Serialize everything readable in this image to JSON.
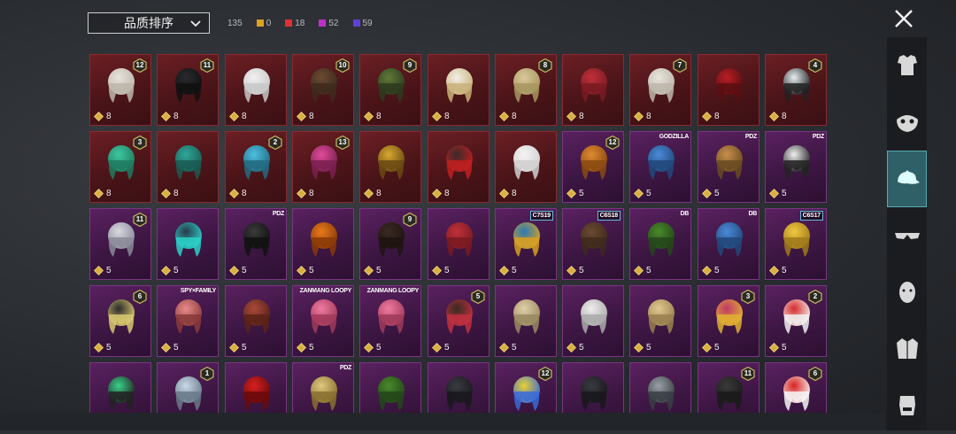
{
  "header": {
    "sort_label": "品质排序",
    "total": "135",
    "stats": [
      {
        "value": "0",
        "color": "#e0a020"
      },
      {
        "value": "18",
        "color": "#e03030"
      },
      {
        "value": "52",
        "color": "#c030c8"
      },
      {
        "value": "59",
        "color": "#6040d8"
      }
    ]
  },
  "sidebar": {
    "categories": [
      "outfit-icon",
      "mask-icon",
      "hat-icon",
      "glasses-icon",
      "face-icon",
      "jacket-icon",
      "emote-icon"
    ],
    "active": "hat-icon"
  },
  "tiles": [
    {
      "rarity": "red",
      "cost": "8",
      "badge": "12",
      "item": "white-hair"
    },
    {
      "rarity": "red",
      "cost": "8",
      "badge": "11",
      "item": "black-helmet"
    },
    {
      "rarity": "red",
      "cost": "8",
      "badge": "",
      "item": "ghost-hair"
    },
    {
      "rarity": "red",
      "cost": "8",
      "badge": "10",
      "item": "brown-hair"
    },
    {
      "rarity": "red",
      "cost": "8",
      "badge": "9",
      "item": "zombie-head"
    },
    {
      "rarity": "red",
      "cost": "8",
      "badge": "",
      "item": "white-hat"
    },
    {
      "rarity": "red",
      "cost": "8",
      "badge": "8",
      "item": "blonde-hair"
    },
    {
      "rarity": "red",
      "cost": "8",
      "badge": "",
      "item": "red-mask"
    },
    {
      "rarity": "red",
      "cost": "8",
      "badge": "7",
      "item": "white-hair"
    },
    {
      "rarity": "red",
      "cost": "8",
      "badge": "",
      "item": "red-helmet"
    },
    {
      "rarity": "red",
      "cost": "8",
      "badge": "4",
      "item": "snowman-head"
    },
    {
      "rarity": "red",
      "cost": "8",
      "badge": "3",
      "item": "green-hair"
    },
    {
      "rarity": "red",
      "cost": "8",
      "badge": "",
      "item": "teal-crest"
    },
    {
      "rarity": "red",
      "cost": "8",
      "badge": "2",
      "item": "blue-cap"
    },
    {
      "rarity": "red",
      "cost": "8",
      "badge": "13",
      "item": "pink-hair"
    },
    {
      "rarity": "red",
      "cost": "8",
      "badge": "",
      "item": "gold-helmet"
    },
    {
      "rarity": "red",
      "cost": "8",
      "badge": "",
      "item": "dark-curly"
    },
    {
      "rarity": "red",
      "cost": "8",
      "badge": "",
      "item": "ghost"
    },
    {
      "rarity": "purple",
      "cost": "5",
      "badge": "12",
      "item": "orange-hair"
    },
    {
      "rarity": "purple",
      "cost": "5",
      "badge": "",
      "item": "blue-hair",
      "logo": "GODZILLA"
    },
    {
      "rarity": "purple",
      "cost": "5",
      "badge": "",
      "item": "lion-head",
      "logo": "PDZ"
    },
    {
      "rarity": "purple",
      "cost": "5",
      "badge": "",
      "item": "panda-head",
      "logo": "PDZ"
    },
    {
      "rarity": "purple",
      "cost": "5",
      "badge": "11",
      "item": "white-veil"
    },
    {
      "rarity": "purple",
      "cost": "5",
      "badge": "",
      "item": "cat-cap"
    },
    {
      "rarity": "purple",
      "cost": "5",
      "badge": "",
      "item": "scythe",
      "logo": "PDZ"
    },
    {
      "rarity": "purple",
      "cost": "5",
      "badge": "",
      "item": "pumpkin"
    },
    {
      "rarity": "purple",
      "cost": "5",
      "badge": "9",
      "item": "dark-hair"
    },
    {
      "rarity": "purple",
      "cost": "5",
      "badge": "",
      "item": "red-mask"
    },
    {
      "rarity": "purple",
      "cost": "5",
      "badge": "",
      "item": "feather-helmet",
      "tag": "C7S19"
    },
    {
      "rarity": "purple",
      "cost": "5",
      "badge": "",
      "item": "brown-hair",
      "tag": "C6S18"
    },
    {
      "rarity": "purple",
      "cost": "5",
      "badge": "",
      "item": "green-helmet",
      "logo": "DB"
    },
    {
      "rarity": "purple",
      "cost": "5",
      "badge": "",
      "item": "blue-hair",
      "logo": "DB"
    },
    {
      "rarity": "purple",
      "cost": "5",
      "badge": "",
      "item": "visor",
      "tag": "C6S17"
    },
    {
      "rarity": "purple",
      "cost": "5",
      "badge": "6",
      "item": "knight-helmet"
    },
    {
      "rarity": "purple",
      "cost": "5",
      "badge": "",
      "item": "pink-bob",
      "logo": "SPY×FAMILY"
    },
    {
      "rarity": "purple",
      "cost": "5",
      "badge": "",
      "item": "witch-hat"
    },
    {
      "rarity": "purple",
      "cost": "5",
      "badge": "",
      "item": "pink-beaver",
      "logo": "ZANMANG LOOPY"
    },
    {
      "rarity": "purple",
      "cost": "5",
      "badge": "",
      "item": "pink-beaver",
      "logo": "ZANMANG LOOPY"
    },
    {
      "rarity": "purple",
      "cost": "5",
      "badge": "5",
      "item": "bow-hair"
    },
    {
      "rarity": "purple",
      "cost": "5",
      "badge": "",
      "item": "curly-blonde"
    },
    {
      "rarity": "purple",
      "cost": "5",
      "badge": "",
      "item": "white-ponytail"
    },
    {
      "rarity": "purple",
      "cost": "5",
      "badge": "",
      "item": "blonde-ponytail"
    },
    {
      "rarity": "purple",
      "cost": "5",
      "badge": "3",
      "item": "jester-hat"
    },
    {
      "rarity": "purple",
      "cost": "5",
      "badge": "2",
      "item": "santa-blonde"
    },
    {
      "rarity": "purple",
      "cost": "",
      "badge": "",
      "item": "green-mask"
    },
    {
      "rarity": "purple",
      "cost": "",
      "badge": "1",
      "item": "silver-hair"
    },
    {
      "rarity": "purple",
      "cost": "",
      "badge": "",
      "item": "red-bow"
    },
    {
      "rarity": "purple",
      "cost": "",
      "badge": "",
      "item": "blonde-bob",
      "logo": "PDZ"
    },
    {
      "rarity": "purple",
      "cost": "",
      "badge": "",
      "item": "green-helmet"
    },
    {
      "rarity": "purple",
      "cost": "",
      "badge": "",
      "item": "dark-helmet"
    },
    {
      "rarity": "purple",
      "cost": "",
      "badge": "12",
      "item": "yellow-helmet"
    },
    {
      "rarity": "purple",
      "cost": "",
      "badge": "",
      "item": "dark-helmet"
    },
    {
      "rarity": "purple",
      "cost": "",
      "badge": "",
      "item": "knight-visor"
    },
    {
      "rarity": "purple",
      "cost": "",
      "badge": "11",
      "item": "dark-bear"
    },
    {
      "rarity": "purple",
      "cost": "",
      "badge": "6",
      "item": "santa-hat"
    }
  ]
}
